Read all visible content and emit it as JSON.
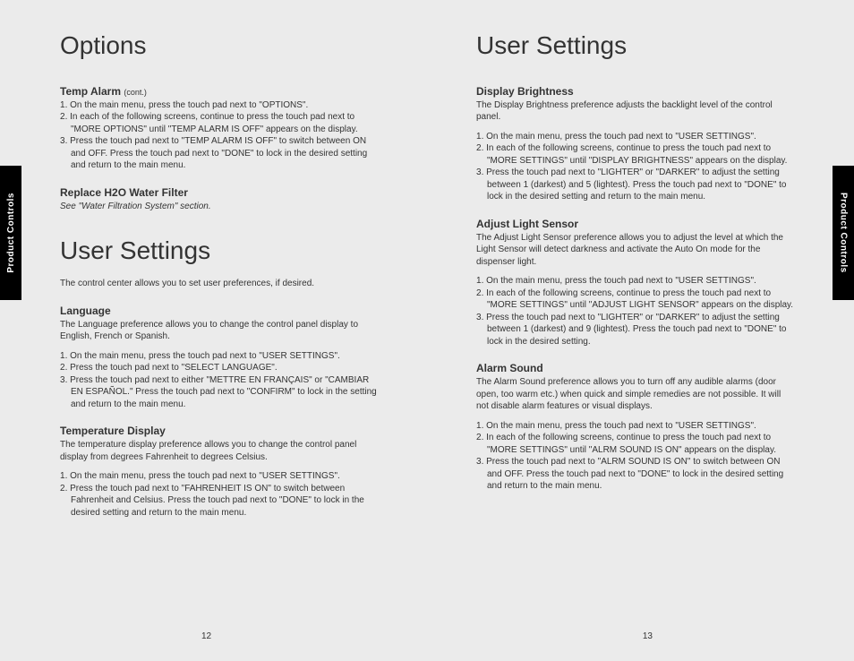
{
  "tab": {
    "left": "Product Controls",
    "right": "Product Controls"
  },
  "left": {
    "title": "Options",
    "tempAlarm": {
      "heading": "Temp Alarm",
      "cont": "(cont.)",
      "steps": [
        "On the main menu, press the touch pad next to \"OPTIONS\".",
        "In each of the following screens, continue to press the touch pad next to \"MORE OPTIONS\" until \"TEMP ALARM IS OFF\" appears on the display.",
        "Press the touch pad next to \"TEMP ALARM IS OFF\" to switch between ON and OFF. Press the touch pad next to \"DONE\" to lock in the desired setting and return to the main menu."
      ]
    },
    "replaceFilter": {
      "heading": "Replace H2O Water Filter",
      "note": "See \"Water Filtration System\" section."
    },
    "userSettingsTitle": "User Settings",
    "userSettingsIntro": "The control center allows you to set user preferences, if desired.",
    "language": {
      "heading": "Language",
      "body": "The Language preference allows you to change the control panel display to English, French or Spanish.",
      "steps": [
        "On the main menu, press the touch pad next to \"USER SETTINGS\".",
        "Press the touch pad next to \"SELECT LANGUAGE\".",
        "Press the touch pad next to either \"METTRE EN FRANÇAIS\" or \"CAMBIAR EN ESPAÑOL.\" Press the touch pad next to \"CONFIRM\" to lock in the setting and return to the main menu."
      ]
    },
    "tempDisplay": {
      "heading": "Temperature Display",
      "body": "The temperature display preference allows you to change the control panel display from degrees Fahrenheit to degrees Celsius.",
      "steps": [
        "On the main menu, press the touch pad next to \"USER SETTINGS\".",
        "Press the touch pad next to \"FAHRENHEIT IS ON\" to switch between Fahrenheit and Celsius. Press the touch pad next to \"DONE\" to lock in the desired setting and return to the main menu."
      ]
    },
    "pageNum": "12"
  },
  "right": {
    "title": "User Settings",
    "displayBrightness": {
      "heading": "Display Brightness",
      "body": "The Display Brightness preference adjusts the backlight level of the control panel.",
      "steps": [
        "On the main menu, press the touch pad next to \"USER SETTINGS\".",
        "In each of the following screens, continue to press the touch pad next to \"MORE SETTINGS\" until \"DISPLAY BRIGHTNESS\" appears on the display.",
        "Press the touch pad next to \"LIGHTER\" or \"DARKER\" to adjust the setting between 1 (darkest) and 5 (lightest). Press the touch pad next to \"DONE\" to lock in the desired setting and return to the main menu."
      ]
    },
    "adjustLightSensor": {
      "heading": "Adjust Light Sensor",
      "body": "The Adjust Light Sensor preference allows you to adjust the level at which the Light Sensor will detect darkness and activate the Auto On mode for the dispenser light.",
      "steps": [
        "On the main menu, press the touch pad next to \"USER SETTINGS\".",
        "In each of the following screens, continue to press the touch pad next to \"MORE SETTINGS\" until \"ADJUST LIGHT SENSOR\" appears on the display.",
        "Press the touch pad next to \"LIGHTER\" or \"DARKER\" to adjust the setting between 1 (darkest) and 9 (lightest). Press the touch pad next to \"DONE\" to lock in the desired setting."
      ]
    },
    "alarmSound": {
      "heading": "Alarm Sound",
      "body": "The Alarm Sound preference allows you to turn off any audible alarms (door open, too warm etc.) when quick and simple remedies are not possible. It will not disable alarm features or visual displays.",
      "steps": [
        "On the main menu, press the touch pad next to \"USER SETTINGS\".",
        "In each of the following screens, continue to press the touch pad next to \"MORE SETTINGS\" until \"ALRM SOUND IS ON\" appears on the display.",
        "Press the touch pad next to \"ALRM SOUND IS ON\" to switch between ON and OFF. Press the touch pad next to \"DONE\" to lock in the desired setting and return to the main menu."
      ]
    },
    "pageNum": "13"
  }
}
